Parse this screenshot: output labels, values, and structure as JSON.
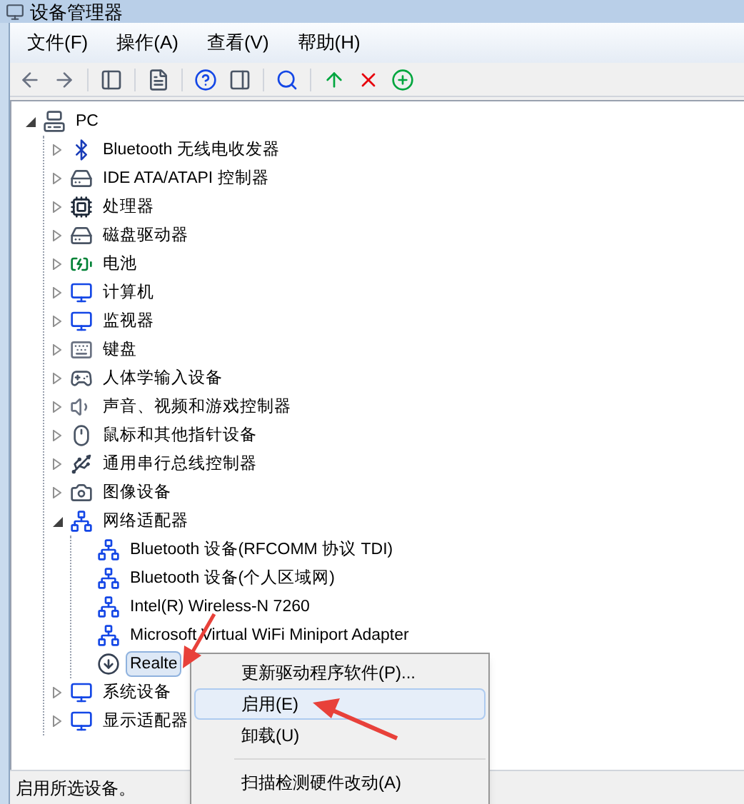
{
  "window": {
    "title": "设备管理器"
  },
  "menu": [
    "文件(F)",
    "操作(A)",
    "查看(V)",
    "帮助(H)"
  ],
  "toolbar": [
    {
      "kind": "back"
    },
    {
      "kind": "forward"
    },
    {
      "kind": "sep"
    },
    {
      "kind": "tree"
    },
    {
      "kind": "sep"
    },
    {
      "kind": "properties"
    },
    {
      "kind": "sep"
    },
    {
      "kind": "help"
    },
    {
      "kind": "pane"
    },
    {
      "kind": "sep"
    },
    {
      "kind": "scan"
    },
    {
      "kind": "sep"
    },
    {
      "kind": "update"
    },
    {
      "kind": "disable"
    },
    {
      "kind": "enable"
    }
  ],
  "tree": [
    {
      "label": "PC",
      "kind": "computer",
      "expanded": true,
      "selected": false,
      "children": [
        {
          "label": "Bluetooth 无线电收发器",
          "kind": "bluetooth",
          "expanded": false,
          "selected": false
        },
        {
          "label": "IDE ATA/ATAPI 控制器",
          "kind": "drive",
          "expanded": false,
          "selected": false
        },
        {
          "label": "处理器",
          "kind": "chip",
          "expanded": false,
          "selected": false
        },
        {
          "label": "磁盘驱动器",
          "kind": "drive",
          "expanded": false,
          "selected": false
        },
        {
          "label": "电池",
          "kind": "battery",
          "expanded": false,
          "selected": false
        },
        {
          "label": "计算机",
          "kind": "monitor",
          "expanded": false,
          "selected": false
        },
        {
          "label": "监视器",
          "kind": "monitor",
          "expanded": false,
          "selected": false
        },
        {
          "label": "键盘",
          "kind": "keyboard",
          "expanded": false,
          "selected": false
        },
        {
          "label": "人体学输入设备",
          "kind": "gamepad",
          "expanded": false,
          "selected": false
        },
        {
          "label": "声音、视频和游戏控制器",
          "kind": "speaker",
          "expanded": false,
          "selected": false
        },
        {
          "label": "鼠标和其他指针设备",
          "kind": "mouse",
          "expanded": false,
          "selected": false
        },
        {
          "label": "通用串行总线控制器",
          "kind": "usb",
          "expanded": false,
          "selected": false
        },
        {
          "label": "图像设备",
          "kind": "camera",
          "expanded": false,
          "selected": false
        },
        {
          "label": "网络适配器",
          "kind": "network",
          "expanded": true,
          "selected": false,
          "children": [
            {
              "label": "Bluetooth 设备(RFCOMM 协议 TDI)",
              "kind": "network",
              "selected": false
            },
            {
              "label": "Bluetooth 设备(个人区域网)",
              "kind": "network",
              "selected": false
            },
            {
              "label": "Intel(R) Wireless-N 7260",
              "kind": "network",
              "selected": false
            },
            {
              "label": "Microsoft Virtual WiFi Miniport Adapter",
              "kind": "network",
              "selected": false
            },
            {
              "label": "Realte",
              "kind": "network-disabled",
              "selected": true
            }
          ]
        },
        {
          "label": "系统设备",
          "kind": "monitor",
          "expanded": false,
          "selected": false
        },
        {
          "label": "显示适配器",
          "kind": "monitor",
          "expanded": false,
          "selected": false
        }
      ]
    }
  ],
  "context_menu": [
    {
      "kind": "item",
      "label": "更新驱动程序软件(P)...",
      "selected": false
    },
    {
      "kind": "item",
      "label": "启用(E)",
      "selected": true
    },
    {
      "kind": "item",
      "label": "卸载(U)",
      "selected": false
    },
    {
      "kind": "sep"
    },
    {
      "kind": "item",
      "label": "扫描检测硬件改动(A)",
      "selected": false
    }
  ],
  "status_bar": "启用所选设备。"
}
